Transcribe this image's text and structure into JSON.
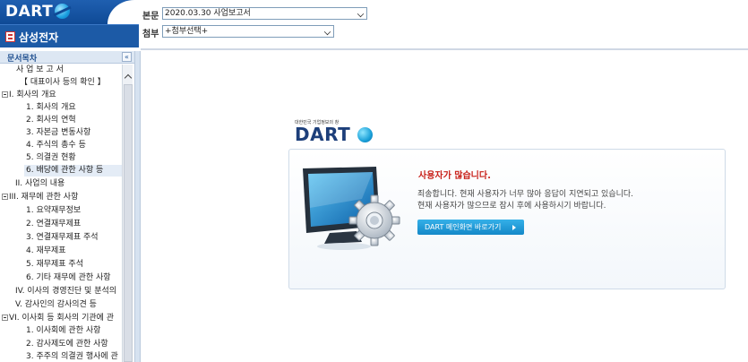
{
  "header": {
    "logo_text": "DART",
    "company_name": "삼성전자",
    "report_label": "본문",
    "report_value": "2020.03.30  사업보고서",
    "attach_label": "첨부",
    "attach_value": "+첨부선택+"
  },
  "toc": {
    "title": "문서목차",
    "collapse_glyph": "«",
    "items": [
      {
        "label": "사 업 보 고 서"
      },
      {
        "label": "【 대표이사 등의 확인 】"
      },
      {
        "label": "I. 회사의 개요"
      },
      {
        "label": "1. 회사의 개요"
      },
      {
        "label": "2. 회사의 연혁"
      },
      {
        "label": "3. 자본금 변동사항"
      },
      {
        "label": "4. 주식의 총수 등"
      },
      {
        "label": "5. 의결권 현황"
      },
      {
        "label": "6. 배당에 관한 사항 등"
      },
      {
        "label": "II. 사업의 내용"
      },
      {
        "label": "III. 재무에 관한 사항"
      },
      {
        "label": "1. 요약재무정보"
      },
      {
        "label": "2. 연결재무제표"
      },
      {
        "label": "3. 연결재무제표 주석"
      },
      {
        "label": "4. 재무제표"
      },
      {
        "label": "5. 재무제표 주석"
      },
      {
        "label": "6. 기타 재무에 관한 사항"
      },
      {
        "label": "IV. 이사의 경영진단 및 분석의"
      },
      {
        "label": "V. 감사인의 감사의견 등"
      },
      {
        "label": "VI. 이사회 등 회사의 기관에 관"
      },
      {
        "label": "1. 이사회에 관한 사항"
      },
      {
        "label": "2. 감사제도에 관한 사항"
      },
      {
        "label": "3. 주주의 의결권 행사에 관"
      }
    ]
  },
  "notice": {
    "tagline": "대한민국 기업정보의 창",
    "logo_word": "DART",
    "title": "사용자가 많습니다.",
    "message_line1": "죄송합니다. 현재 사용자가 너무 많아 응답이 지연되고 있습니다.",
    "message_line2": "현재 사용자가 많으므로 잠시 후에 사용하시기 바랍니다.",
    "button_label": "DART 메인화면 바로가기"
  },
  "colors": {
    "brand_blue": "#1c5aa6",
    "alert_red": "#c8211a",
    "button_blue": "#1f96d6"
  }
}
